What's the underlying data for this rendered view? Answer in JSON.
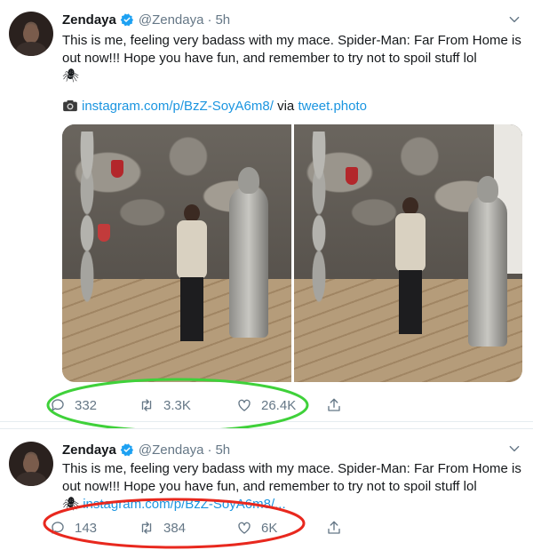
{
  "tweets": [
    {
      "name": "Zendaya",
      "handle": "@Zendaya",
      "dot": "·",
      "time": "5h",
      "text": "This is me, feeling very badass with my mace. Spider-Man: Far From Home is out now!!! Hope you have fun, and remember to try not to spoil stuff lol",
      "spider": "🕷",
      "link": "instagram.com/p/BzZ-SoyA6m8/",
      "via_label": "via",
      "via_link": "tweet.photo",
      "replies": "332",
      "retweets": "3.3K",
      "likes": "26.4K"
    },
    {
      "name": "Zendaya",
      "handle": "@Zendaya",
      "dot": "·",
      "time": "5h",
      "text": "This is me, feeling very badass with my mace. Spider-Man: Far From Home is out now!!! Hope you have fun, and remember to try not to spoil stuff lol",
      "spider": "🕷",
      "link": "instagram.com/p/BzZ-SoyA6m8/...",
      "replies": "143",
      "retweets": "384",
      "likes": "6K"
    }
  ],
  "colors": {
    "link": "#1b95e0",
    "verified": "#1da1f2",
    "highlight_top": "#3fd13a",
    "highlight_bottom": "#e8281e",
    "muted": "#657786"
  },
  "icons": [
    "avatar-photo",
    "verified-badge-icon",
    "chevron-down-icon",
    "camera-icon",
    "reply-icon",
    "retweet-icon",
    "like-icon",
    "share-icon"
  ]
}
